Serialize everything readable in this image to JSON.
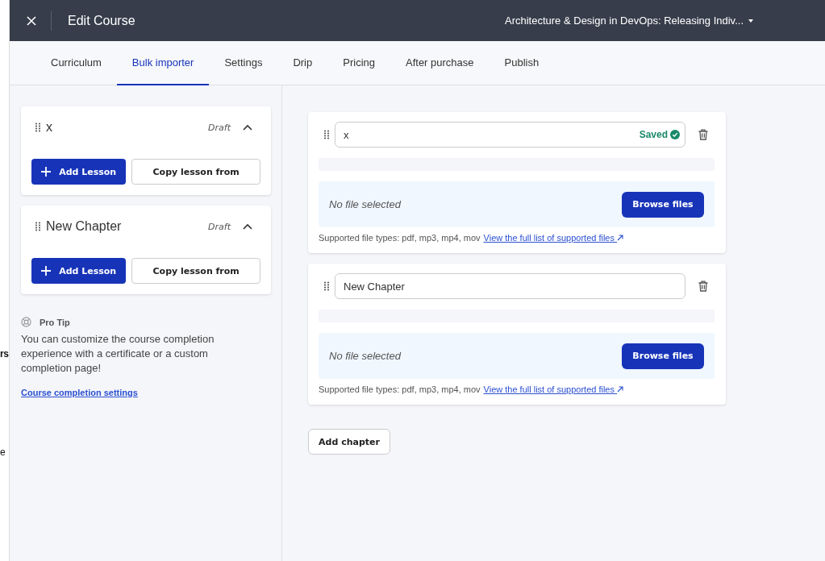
{
  "background_page": {
    "fragments": [
      "rs",
      "e"
    ]
  },
  "header": {
    "title": "Edit Course",
    "course_selector": "Architecture & Design in DevOps: Releasing Indiv..."
  },
  "tabs": [
    {
      "label": "Curriculum",
      "selected": false
    },
    {
      "label": "Bulk importer",
      "selected": true
    },
    {
      "label": "Settings",
      "selected": false
    },
    {
      "label": "Drip",
      "selected": false
    },
    {
      "label": "Pricing",
      "selected": false
    },
    {
      "label": "After purchase",
      "selected": false
    },
    {
      "label": "Publish",
      "selected": false
    }
  ],
  "sidebar": {
    "chapters": [
      {
        "title": "x",
        "status": "Draft",
        "expanded": true,
        "add_button": "Add Lesson",
        "copy_button": "Copy lesson from"
      },
      {
        "title": "New Chapter",
        "status": "Draft",
        "expanded": true,
        "add_button": "Add Lesson",
        "copy_button": "Copy lesson from"
      }
    ],
    "pro_tip": {
      "title": "Pro Tip",
      "text": "You can customize the course completion experience with a certificate or a custom completion page!",
      "link": "Course completion settings"
    }
  },
  "importer": {
    "chapters": [
      {
        "name": "x",
        "saved": true,
        "saved_label": "Saved",
        "file_status": "No file selected",
        "browse_button": "Browse files",
        "supported_text": "Supported file types: pdf, mp3, mp4, mov",
        "supported_link": "View the full list of supported files"
      },
      {
        "name": "New Chapter",
        "saved": false,
        "file_status": "No file selected",
        "browse_button": "Browse files",
        "supported_text": "Supported file types: pdf, mp3, mp4, mov",
        "supported_link": "View the full list of supported files"
      }
    ],
    "add_chapter_button": "Add chapter"
  }
}
